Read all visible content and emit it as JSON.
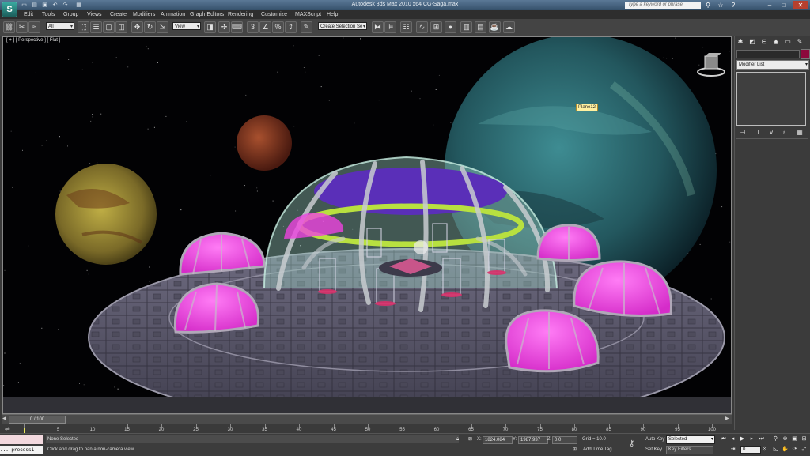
{
  "title": {
    "text": "Autodesk 3ds Max 2010 x64    CG-Saga.max",
    "search_placeholder": "Type a keyword or phrase",
    "quick_access": [
      "new-icon",
      "open-icon",
      "save-icon",
      "undo-icon",
      "redo-icon",
      "project-icon"
    ]
  },
  "menu": [
    "Edit",
    "Tools",
    "Group",
    "Views",
    "Create",
    "Modifiers",
    "Animation",
    "Graph Editors",
    "Rendering",
    "Customize",
    "MAXScript",
    "Help"
  ],
  "toolbar": {
    "filter_dropdown": "All",
    "coord_dropdown": "View",
    "selection_set": "Create Selection Se"
  },
  "viewport": {
    "label": "[ + ] [ Perspective ] [ Flat ]",
    "tooltip": "Plane12",
    "colors": {
      "dome_glass": "#9ad0c0",
      "dome_top": "#5a2fb8",
      "ring": "#b8e040",
      "pods": "#ee44e0",
      "hull": "#5d5a6e",
      "planet_blue": "#2d6f78",
      "planet_red": "#8c3a22",
      "planet_yellow": "#a8982e"
    }
  },
  "command_panel": {
    "tabs": [
      "create-icon",
      "modify-icon",
      "hierarchy-icon",
      "motion-icon",
      "display-icon",
      "utilities-icon"
    ],
    "object_color": "#8c0a3c",
    "modifier_list": "Modifier List",
    "stack_tools": [
      "pin-stack-icon",
      "show-end-result-icon",
      "make-unique-icon",
      "remove-modifier-icon",
      "configure-modifier-sets-icon"
    ]
  },
  "timeline": {
    "slider_label": "0 / 100",
    "current_frame": 0,
    "ticks": [
      0,
      5,
      10,
      15,
      20,
      25,
      30,
      35,
      40,
      45,
      50,
      55,
      60,
      65,
      70,
      75,
      80,
      85,
      90,
      95,
      100
    ]
  },
  "status": {
    "listener_text": "... processi",
    "selected_text": "None Selected",
    "prompt_text": "Click and drag to pan a non-camera view",
    "x_label": "X:",
    "x_value": "1824.084",
    "y_label": "Y:",
    "y_value": "1987.937",
    "z_label": "Z:",
    "z_value": "0.0",
    "grid": "Grid = 10.0",
    "add_time_tag": "Add Time Tag",
    "auto_key": "Auto Key",
    "set_key": "Set Key",
    "key_mode": "Selected",
    "key_filters": "Key Filters...",
    "frame_value": "0"
  }
}
